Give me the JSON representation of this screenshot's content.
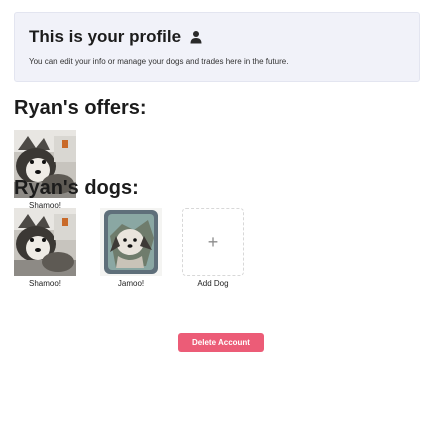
{
  "banner": {
    "title": "This is your profile",
    "subtitle": "You can edit your info or manage your dogs and trades here in the future.",
    "icon": "user-icon"
  },
  "offers": {
    "title": "Ryan's offers:",
    "items": [
      {
        "name": "Shamoo!",
        "photo": "husky-photo"
      }
    ]
  },
  "dogs": {
    "title": "Ryan's dogs:",
    "items": [
      {
        "name": "Shamoo!",
        "photo": "husky-photo"
      },
      {
        "name": "Jamoo!",
        "photo": "puppy-photo"
      }
    ],
    "add_label": "Add Dog",
    "add_icon": "+"
  },
  "actions": {
    "delete_label": "Delete Account"
  },
  "colors": {
    "banner_bg": "#f1f2f9",
    "delete_bg": "#ec5c77"
  }
}
